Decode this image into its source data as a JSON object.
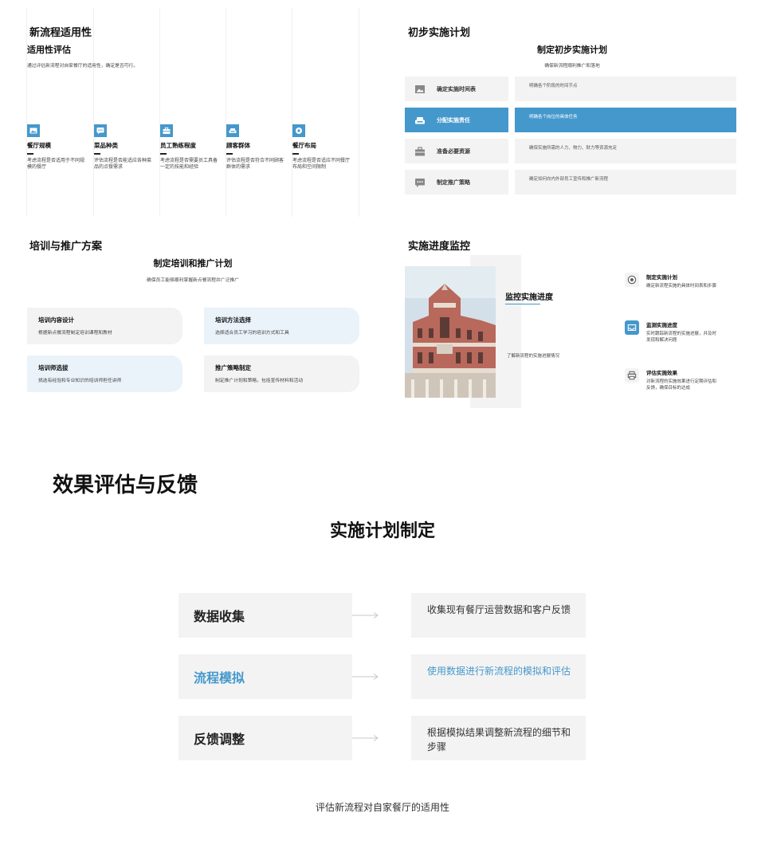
{
  "theme": {
    "accent": "#4598cc",
    "panel": "#f3f3f3",
    "card_light": "#f3f3f3",
    "card_blue": "#eaf3f9"
  },
  "slide1": {
    "title": "新流程适用性",
    "subtitle": "适用性评估",
    "description": "通过评估新流程对自家餐厅的适用性，确定是否可行。",
    "items": [
      {
        "icon": "image-icon",
        "name": "餐厅规模",
        "desc": "考虑流程是否适用于不同规模的餐厅"
      },
      {
        "icon": "chat-icon",
        "name": "菜品种类",
        "desc": "评估流程是否能适应各种菜品的点餐需求"
      },
      {
        "icon": "briefcase-icon",
        "name": "员工熟练程度",
        "desc": "考虑流程是否需要员工具备一定的技能和经验"
      },
      {
        "icon": "sofa-icon",
        "name": "顾客群体",
        "desc": "评估流程是否符合不同顾客群体的需求"
      },
      {
        "icon": "location-icon",
        "name": "餐厅布局",
        "desc": "考虑流程是否适应不同餐厅布局和空间限制"
      }
    ]
  },
  "slide2": {
    "title": "初步实施计划",
    "heading": "制定初步实施计划",
    "subheading": "确保新流程顺利推广和落地",
    "rows": [
      {
        "icon": "image-icon",
        "label": "确定实施时间表",
        "desc": "明确各个阶段的时间节点",
        "active": false
      },
      {
        "icon": "sofa-icon",
        "label": "分配实施责任",
        "desc": "明确各个岗位的具体任务",
        "active": true
      },
      {
        "icon": "briefcase-icon",
        "label": "准备必要资源",
        "desc": "确保实施所需的人力、物力、财力等资源充足",
        "active": false
      },
      {
        "icon": "chat-icon",
        "label": "制定推广策略",
        "desc": "确定如何向内外部员工宣传和推广新流程",
        "active": false
      }
    ]
  },
  "slide3": {
    "title": "培训与推广方案",
    "heading": "制定培训和推广计划",
    "subheading": "确保员工能够顺利掌握新点餐流程并广泛推广",
    "cards": [
      {
        "title": "培训内容设计",
        "desc": "根据新点餐流程制定培训课程和教材",
        "tone": "light"
      },
      {
        "title": "培训方法选择",
        "desc": "选择适合员工学习的培训方式和工具",
        "tone": "blue"
      },
      {
        "title": "培训师选拔",
        "desc": "挑选有经验和专业知识的培训师担任讲师",
        "tone": "blue"
      },
      {
        "title": "推广策略制定",
        "desc": "制定推广计划和策略，包括宣传材料和活动",
        "tone": "light"
      }
    ]
  },
  "slide4": {
    "title": "实施进度监控",
    "photo_label": "building-photo",
    "heading": "监控实施进度",
    "description": "了解新流程的实施进展情况",
    "items": [
      {
        "icon": "target-icon",
        "title": "制定实施计划",
        "desc": "确定新流程实施的具体时间表和步骤",
        "active": false
      },
      {
        "icon": "tray-icon",
        "title": "监测实施进度",
        "desc": "实时跟踪新流程的实施进展，并及时发现和解决问题",
        "active": true
      },
      {
        "icon": "printer-icon",
        "title": "评估实施效果",
        "desc": "对新流程的实施效果进行定期评估和反馈，确保目标的达成",
        "active": false
      }
    ]
  },
  "slide5": {
    "title": "效果评估与反馈",
    "heading": "实施计划制定",
    "rows": [
      {
        "label": "数据收集",
        "desc": "收集现有餐厅运营数据和客户反馈",
        "active": false
      },
      {
        "label": "流程模拟",
        "desc": "使用数据进行新流程的模拟和评估",
        "active": true
      },
      {
        "label": "反馈调整",
        "desc": "根据模拟结果调整新流程的细节和步骤",
        "active": false
      }
    ],
    "footer": "评估新流程对自家餐厅的适用性"
  }
}
